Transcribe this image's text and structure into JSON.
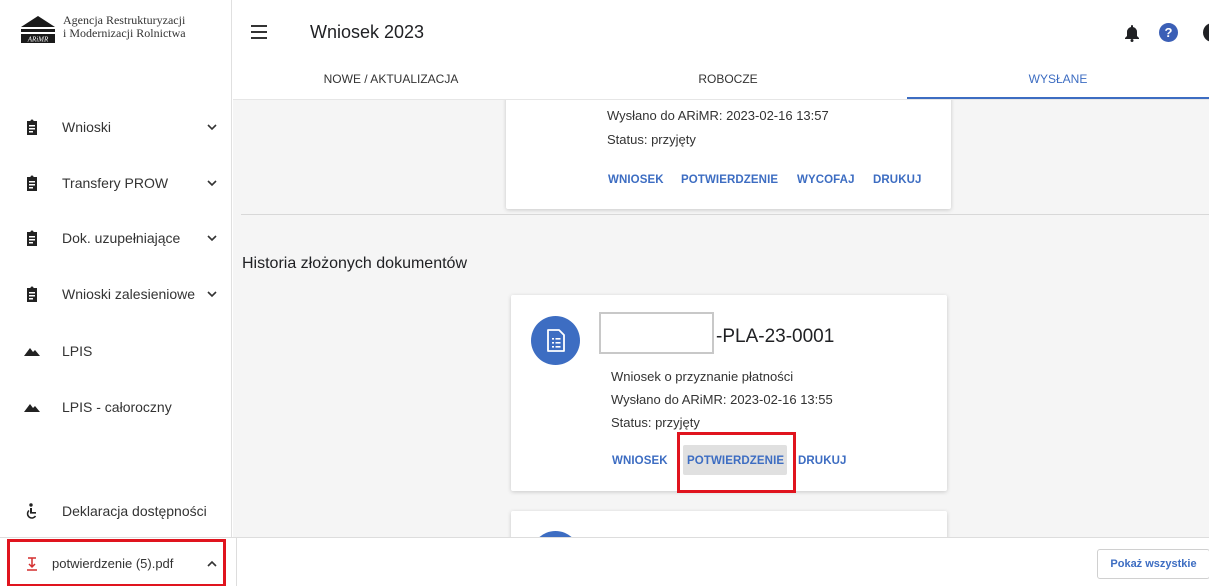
{
  "brand": {
    "line1": "Agencja Restrukturyzacji",
    "line2": "i Modernizacji Rolnictwa",
    "logo_text": "ARiMR"
  },
  "header": {
    "title": "Wniosek 2023"
  },
  "tabs": [
    {
      "label": "NOWE / AKTUALIZACJA"
    },
    {
      "label": "ROBOCZE"
    },
    {
      "label": "WYSŁANE",
      "active": true
    }
  ],
  "sidebar": {
    "items": [
      {
        "label": "Wnioski",
        "icon": "clipboard-icon"
      },
      {
        "label": "Transfery PROW",
        "icon": "clipboard-icon"
      },
      {
        "label": "Dok. uzupełniające",
        "icon": "clipboard-icon"
      },
      {
        "label": "Wnioski zalesieniowe",
        "icon": "clipboard-icon"
      },
      {
        "label": "LPIS",
        "icon": "terrain-icon"
      },
      {
        "label": "LPIS - całoroczny",
        "icon": "terrain-icon"
      }
    ],
    "accessibility": {
      "label": "Deklaracja dostępności",
      "icon": "accessibility-icon"
    }
  },
  "current_card": {
    "sent": "Wysłano do ARiMR: 2023-02-16 13:57",
    "status": "Status: przyjęty",
    "actions": {
      "wniosek": "WNIOSEK",
      "potwierdzenie": "POTWIERDZENIE",
      "wycofaj": "WYCOFAJ",
      "drukuj": "DRUKUJ"
    }
  },
  "history": {
    "title": "Historia złożonych dokumentów",
    "card": {
      "code_suffix": "-PLA-23-0001",
      "description": "Wniosek o przyznanie płatności",
      "sent": "Wysłano do ARiMR: 2023-02-16 13:55",
      "status": "Status: przyjęty",
      "actions": {
        "wniosek": "WNIOSEK",
        "potwierdzenie": "POTWIERDZENIE",
        "drukuj": "DRUKUJ"
      }
    }
  },
  "downloads": {
    "file_name": "potwierdzenie (5).pdf",
    "show_all": "Pokaż wszystkie"
  },
  "colors": {
    "accent": "#3d6dc2",
    "highlight_frame": "#e0141e"
  }
}
